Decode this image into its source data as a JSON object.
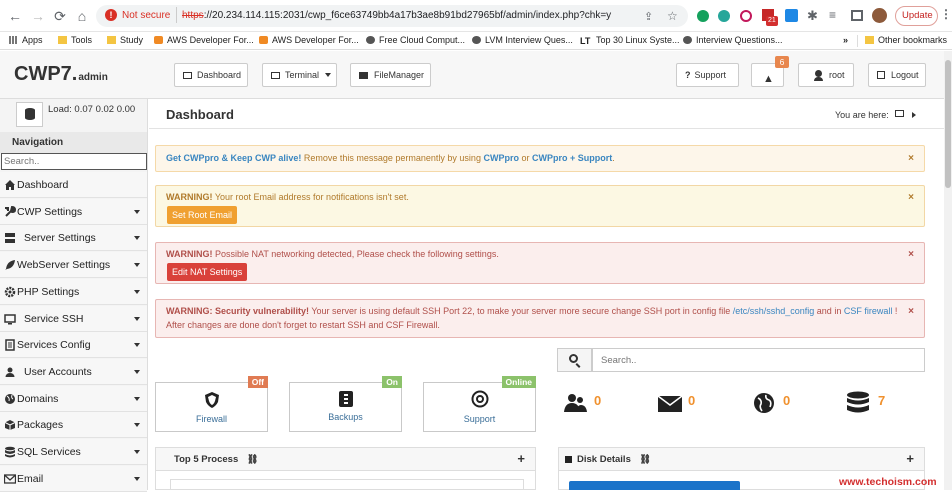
{
  "browser": {
    "security": "Not secure",
    "url_scheme": "https",
    "url_rest": "://20.234.114.115:2031/cwp_f6ce63749bb4a17b3ae8b91bd27965bf/admin/index.php?chk=y",
    "update_label": "Update",
    "ext_badge": "21",
    "bookmarks": [
      "Apps",
      "Tools",
      "Study",
      "AWS Developer For...",
      "AWS Developer For...",
      "Free Cloud Comput...",
      "LVM Interview Ques...",
      "Top 30 Linux Syste...",
      "Interview Questions..."
    ],
    "bookmarks_more": "»",
    "other_bookmarks": "Other bookmarks"
  },
  "header": {
    "logo_main": "CWP7",
    "logo_dot": ".",
    "logo_sub": "admin",
    "tabs": {
      "dashboard": "Dashboard",
      "terminal": "Terminal",
      "filemanager": "FileManager"
    },
    "support": "Support",
    "notif_count": "6",
    "user": "root",
    "logout": "Logout"
  },
  "load": {
    "label": "Load:",
    "v1": "0.07",
    "v2": "0.02",
    "v3": "0.00"
  },
  "sidebar": {
    "title": "Navigation",
    "search_placeholder": "Search..",
    "items": [
      {
        "label": "Dashboard",
        "icon": "home-icon",
        "caret": false
      },
      {
        "label": "CWP Settings",
        "icon": "wrench-icon",
        "caret": true
      },
      {
        "label": "Server Settings",
        "icon": "server-icon",
        "caret": true
      },
      {
        "label": "WebServer Settings",
        "icon": "feather-icon",
        "caret": true
      },
      {
        "label": "PHP Settings",
        "icon": "gear-icon",
        "caret": true
      },
      {
        "label": "Service SSH",
        "icon": "monitor-icon",
        "caret": true
      },
      {
        "label": "Services Config",
        "icon": "document-icon",
        "caret": true
      },
      {
        "label": "User Accounts",
        "icon": "user-icon",
        "caret": true
      },
      {
        "label": "Domains",
        "icon": "globe-icon",
        "caret": true
      },
      {
        "label": "Packages",
        "icon": "cube-icon",
        "caret": true
      },
      {
        "label": "SQL Services",
        "icon": "database-icon",
        "caret": true
      },
      {
        "label": "Email",
        "icon": "envelope-icon",
        "caret": true
      }
    ]
  },
  "page": {
    "title": "Dashboard",
    "you_are_here": "You are here:"
  },
  "alerts": {
    "promo": {
      "b1": "Get CWPpro & Keep CWP alive!",
      "t1": " Remove this message permanently by using ",
      "l1": "CWPpro",
      "t2": " or ",
      "l2": "CWPpro + Support",
      "t3": "."
    },
    "email": {
      "b": "WARNING!",
      "t": " Your root Email address for notifications isn't set.",
      "btn": "Set Root Email"
    },
    "nat": {
      "b": "WARNING!",
      "t": " Possible NAT networking detected, Please check the following settings.",
      "btn": "Edit NAT Settings"
    },
    "ssh": {
      "b": "WARNING: Security vulnerability!",
      "t1": " Your server is using default SSH Port 22, to make your server more secure change SSH port in config file ",
      "l1": "/etc/ssh/sshd_config",
      "t2": " and in ",
      "l2": "CSF firewall",
      "t3": " !",
      "line2": "After changes are done don't forget to restart SSH and CSF Firewall."
    },
    "close": "×"
  },
  "search": {
    "placeholder": "Search.."
  },
  "services": [
    {
      "label": "Firewall",
      "badge": "Off",
      "badge_color": "#e07b53"
    },
    {
      "label": "Backups",
      "badge": "On",
      "badge_color": "#8cc26b"
    },
    {
      "label": "Support",
      "badge": "Online",
      "badge_color": "#8cc26b"
    }
  ],
  "stats": {
    "users": "0",
    "emails": "0",
    "domains": "0",
    "databases": "7"
  },
  "panels": {
    "top5": "Top 5 Process",
    "disk": "Disk Details",
    "plus": "+"
  },
  "watermark": "www.techoism.com"
}
